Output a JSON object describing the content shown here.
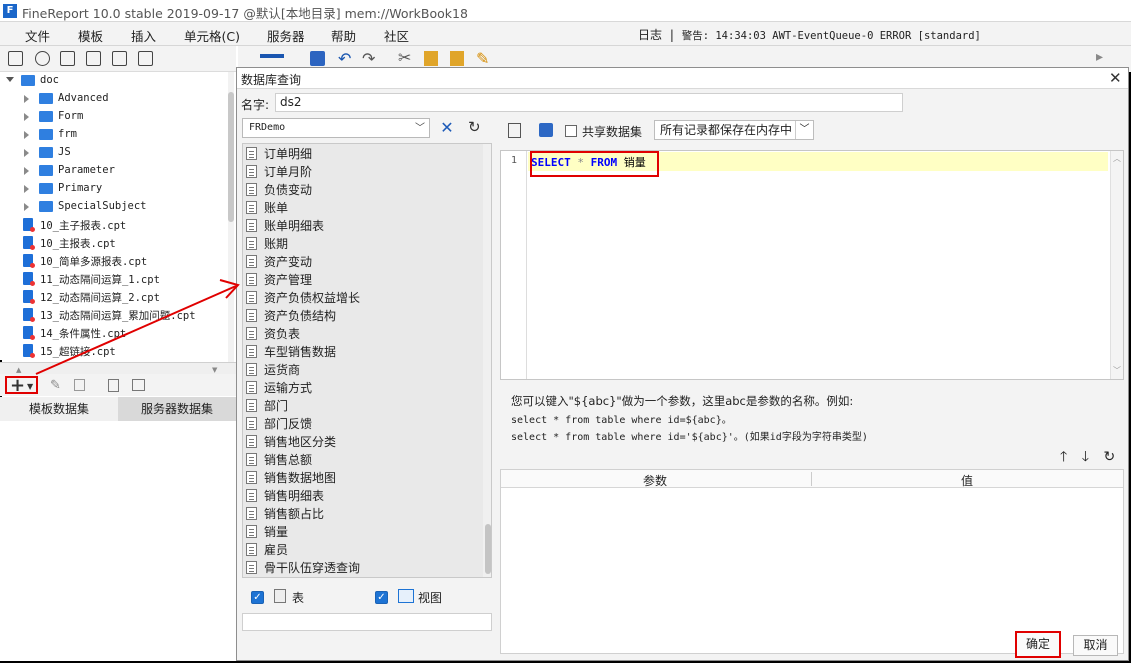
{
  "app": {
    "title": "FineReport 10.0 stable 2019-09-17 @默认[本地目录]     mem://WorkBook18"
  },
  "menu": [
    "文件",
    "模板",
    "插入",
    "单元格(C)",
    "服务器",
    "帮助",
    "社区"
  ],
  "log": {
    "label": "日志",
    "separator": "|",
    "warning": "警告: 14:34:03 AWT-EventQueue-0 ERROR [standard]"
  },
  "tree": [
    {
      "label": "doc",
      "type": "folder",
      "expanded": true,
      "level": 0
    },
    {
      "label": "Advanced",
      "type": "folder",
      "level": 1
    },
    {
      "label": "Form",
      "type": "folder",
      "level": 1
    },
    {
      "label": "frm",
      "type": "folder",
      "level": 1
    },
    {
      "label": "JS",
      "type": "folder",
      "level": 1
    },
    {
      "label": "Parameter",
      "type": "folder",
      "level": 1
    },
    {
      "label": "Primary",
      "type": "folder",
      "level": 1
    },
    {
      "label": "SpecialSubject",
      "type": "folder",
      "level": 1
    },
    {
      "label": "10_主子报表.cpt",
      "type": "file",
      "level": 1
    },
    {
      "label": "10_主报表.cpt",
      "type": "file",
      "level": 1
    },
    {
      "label": "10_简单多源报表.cpt",
      "type": "file",
      "level": 1
    },
    {
      "label": "11_动态隔间运算_1.cpt",
      "type": "file",
      "level": 1
    },
    {
      "label": "12_动态隔间运算_2.cpt",
      "type": "file",
      "level": 1
    },
    {
      "label": "13_动态隔间运算_累加问题.cpt",
      "type": "file",
      "level": 1
    },
    {
      "label": "14_条件属性.cpt",
      "type": "file",
      "level": 1
    },
    {
      "label": "15_超链接.cpt",
      "type": "file",
      "level": 1
    }
  ],
  "dataset_tabs": [
    "模板数据集",
    "服务器数据集"
  ],
  "dialog": {
    "title": "数据库查询",
    "close": "✕",
    "name_label": "名字:",
    "name_value": "ds2",
    "connection": "FRDemo",
    "tables": [
      "订单明细",
      "订单月阶",
      "负债变动",
      "账单",
      "账单明细表",
      "账期",
      "资产变动",
      "资产管理",
      "资产负债权益增长",
      "资产负债结构",
      "资负表",
      "车型销售数据",
      "运货商",
      "运输方式",
      "部门",
      "部门反馈",
      "销售地区分类",
      "销售总额",
      "销售数据地图",
      "销售明细表",
      "销售额占比",
      "销量",
      "雇员",
      "骨干队伍穿透查询"
    ],
    "filter": {
      "table_label": "表",
      "view_label": "视图",
      "table_checked": true,
      "view_checked": true
    },
    "share_label": "共享数据集",
    "storage_option": "所有记录都保存在内存中",
    "sql": {
      "line_no": "1",
      "kw1": "SELECT",
      "star": "*",
      "kw2": "FROM",
      "table": "销量"
    },
    "hint": {
      "line1": "您可以键入\"${abc}\"做为一个参数，这里abc是参数的名称。例如:",
      "line2": "select * from table where id=${abc}。",
      "line3": "select * from table where id='${abc}'。(如果id字段为字符串类型)"
    },
    "param_headers": {
      "param": "参数",
      "value": "值"
    },
    "ok": "确定",
    "cancel": "取消"
  },
  "colors": {
    "accent": "#1d73d4",
    "highlight_red": "#e00000",
    "keyword": "#0000ff",
    "line_highlight": "#ffffc4"
  }
}
